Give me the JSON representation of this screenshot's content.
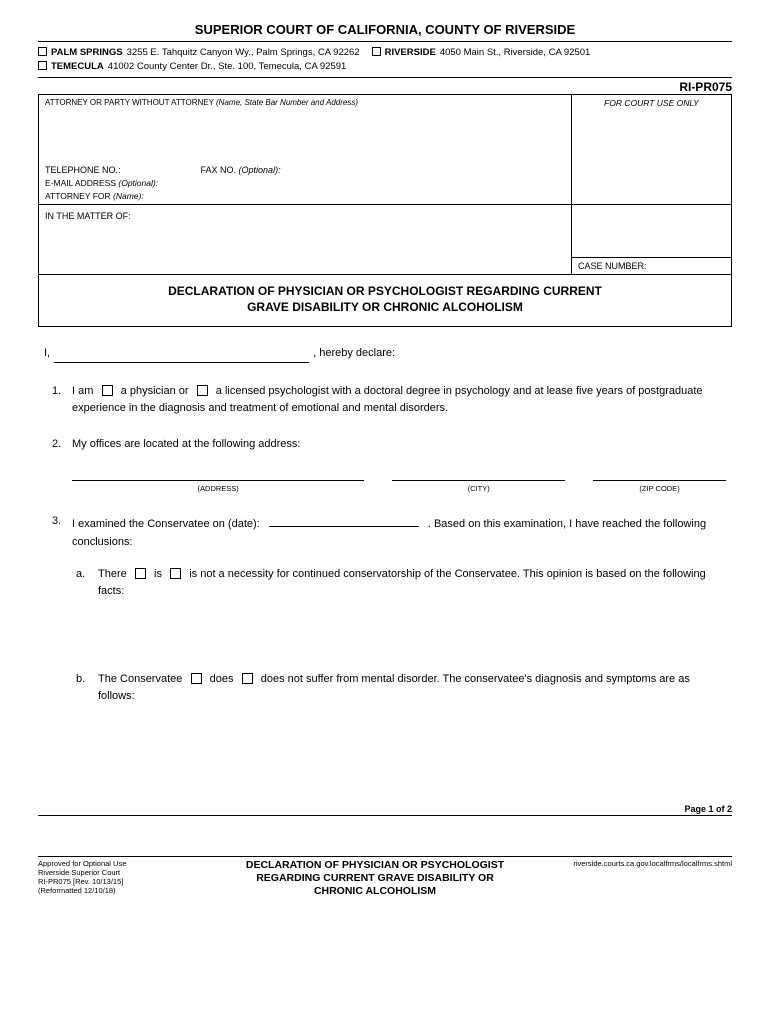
{
  "court_title": "SUPERIOR COURT OF CALIFORNIA, COUNTY OF RIVERSIDE",
  "locations": [
    {
      "name": "PALM SPRINGS",
      "addr": "3255 E. Tahquitz Canyon Wy., Palm Springs, CA 92262"
    },
    {
      "name": "RIVERSIDE",
      "addr": "4050 Main St., Riverside, CA 92501"
    },
    {
      "name": "TEMECULA",
      "addr": "41002 County Center Dr., Ste. 100, Temecula, CA 92591"
    }
  ],
  "form_number": "RI-PR075",
  "caption": {
    "attorney_hdr": "ATTORNEY OR PARTY WITHOUT ATTORNEY",
    "attorney_hdr_ital": "(Name, State Bar Number and Address)",
    "court_use": "FOR COURT USE ONLY",
    "tel": "TELEPHONE NO.:",
    "fax": "FAX NO.",
    "fax_ital": "(Optional):",
    "email": "E-MAIL ADDRESS",
    "email_ital": "(Optional):",
    "atty_for": "ATTORNEY FOR",
    "atty_for_ital": "(Name):",
    "matter": "IN THE MATTER OF:",
    "case": "CASE NUMBER:"
  },
  "form_title_l1": "DECLARATION OF PHYSICIAN OR PSYCHOLOGIST REGARDING CURRENT",
  "form_title_l2": "GRAVE DISABILITY OR CHRONIC ALCOHOLISM",
  "declare": {
    "prefix": "I,",
    "suffix": ", hereby declare:"
  },
  "item1": {
    "pre": "I am",
    "opt1": "a physician or",
    "opt2": "a licensed psychologist with a doctoral degree in psychology and at lease five years of postgraduate experience in the diagnosis and treatment of emotional and mental disorders."
  },
  "item2": "My offices are located at the following address:",
  "addr_labels": {
    "address": "(ADDRESS)",
    "city": "(CITY)",
    "zip": "(ZIP CODE)"
  },
  "item3": {
    "pre": "I examined the Conservatee on (date):",
    "post": ".  Based on this examination, I have reached the following conclusions:"
  },
  "item3a": {
    "pre": "There",
    "opt1": "is",
    "opt2": "is not a necessity for continued conservatorship of the Conservatee.  This opinion is based on the following facts:"
  },
  "item3b": {
    "pre": "The Conservatee",
    "opt1": "does",
    "opt2": "does not suffer from mental disorder.  The conservatee's diagnosis and symptoms are as follows:"
  },
  "footer": {
    "page": "Page 1 of 2",
    "approved1": "Approved for Optional Use",
    "approved2": "Riverside Superior Court",
    "approved3": "RI-PR075 [Rev. 10/13/15]",
    "approved4": "(Reformatted 12/10/18)",
    "title1": "DECLARATION OF PHYSICIAN OR PSYCHOLOGIST",
    "title2": "REGARDING CURRENT GRAVE DISABILITY OR",
    "title3": "CHRONIC ALCOHOLISM",
    "url": "riverside.courts.ca.gov.localfrms/localfrms.shtml"
  }
}
